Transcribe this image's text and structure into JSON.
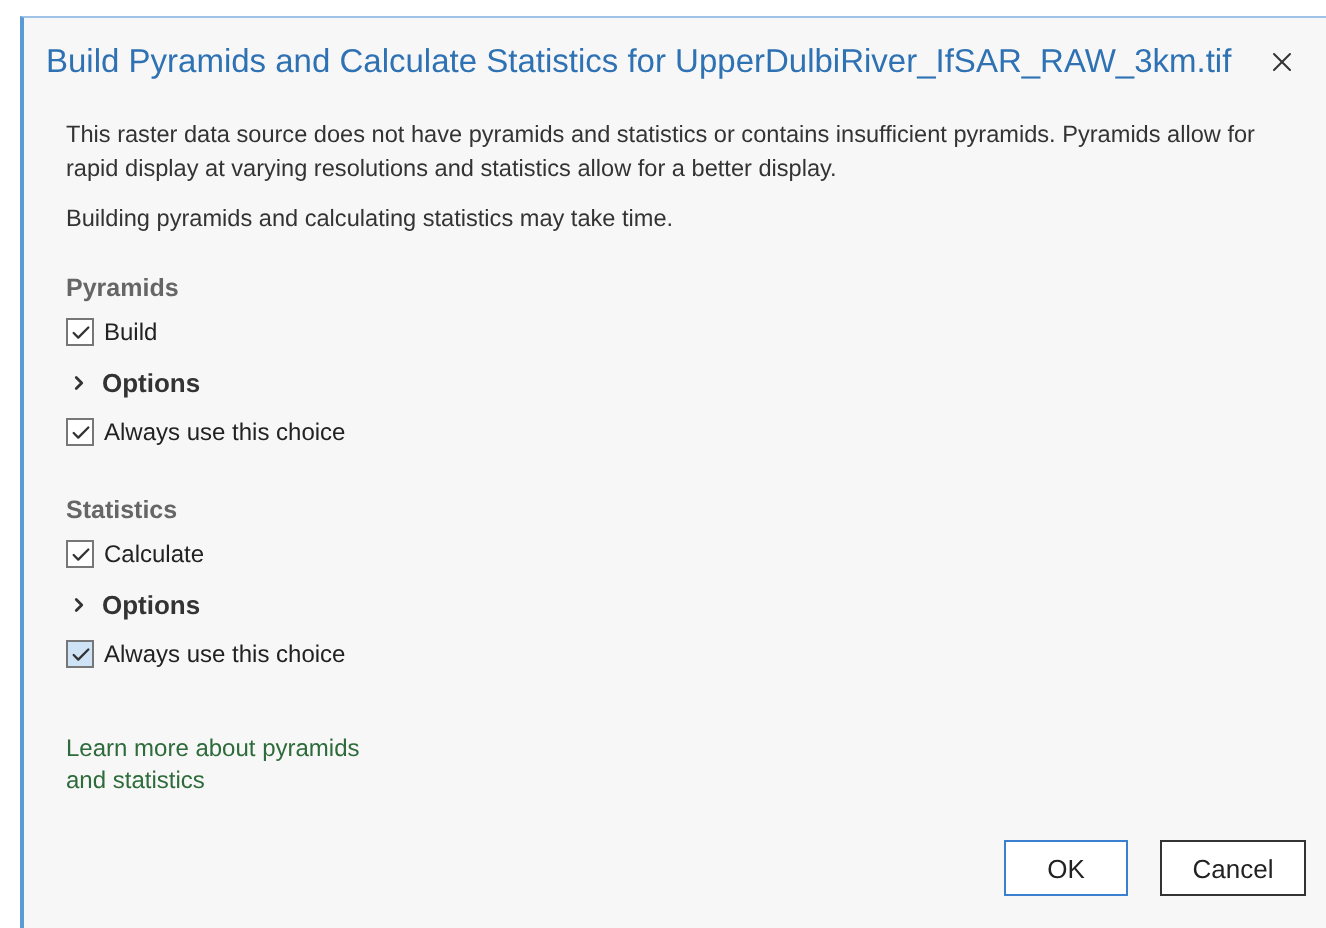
{
  "window": {
    "title": "Build Pyramids and Calculate Statistics for UpperDulbiRiver_IfSAR_RAW_3km.tif"
  },
  "description": [
    "This raster data source does not have pyramids and statistics or contains insufficient pyramids. Pyramids allow for rapid display at varying resolutions and statistics allow for a better display.",
    "Building pyramids and calculating statistics may take time."
  ],
  "sections": [
    {
      "title": "Pyramids",
      "action": {
        "label": "Build",
        "checked": true,
        "hovered": false
      },
      "options": {
        "label": "Options",
        "expanded": false
      },
      "always": {
        "label": "Always use this choice",
        "checked": true,
        "hovered": false
      }
    },
    {
      "title": "Statistics",
      "action": {
        "label": "Calculate",
        "checked": true,
        "hovered": false
      },
      "options": {
        "label": "Options",
        "expanded": false
      },
      "always": {
        "label": "Always use this choice",
        "checked": true,
        "hovered": true
      }
    }
  ],
  "link": "Learn more about pyramids and statistics",
  "buttons": [
    {
      "label": "OK",
      "default": true
    },
    {
      "label": "Cancel",
      "default": false
    }
  ]
}
